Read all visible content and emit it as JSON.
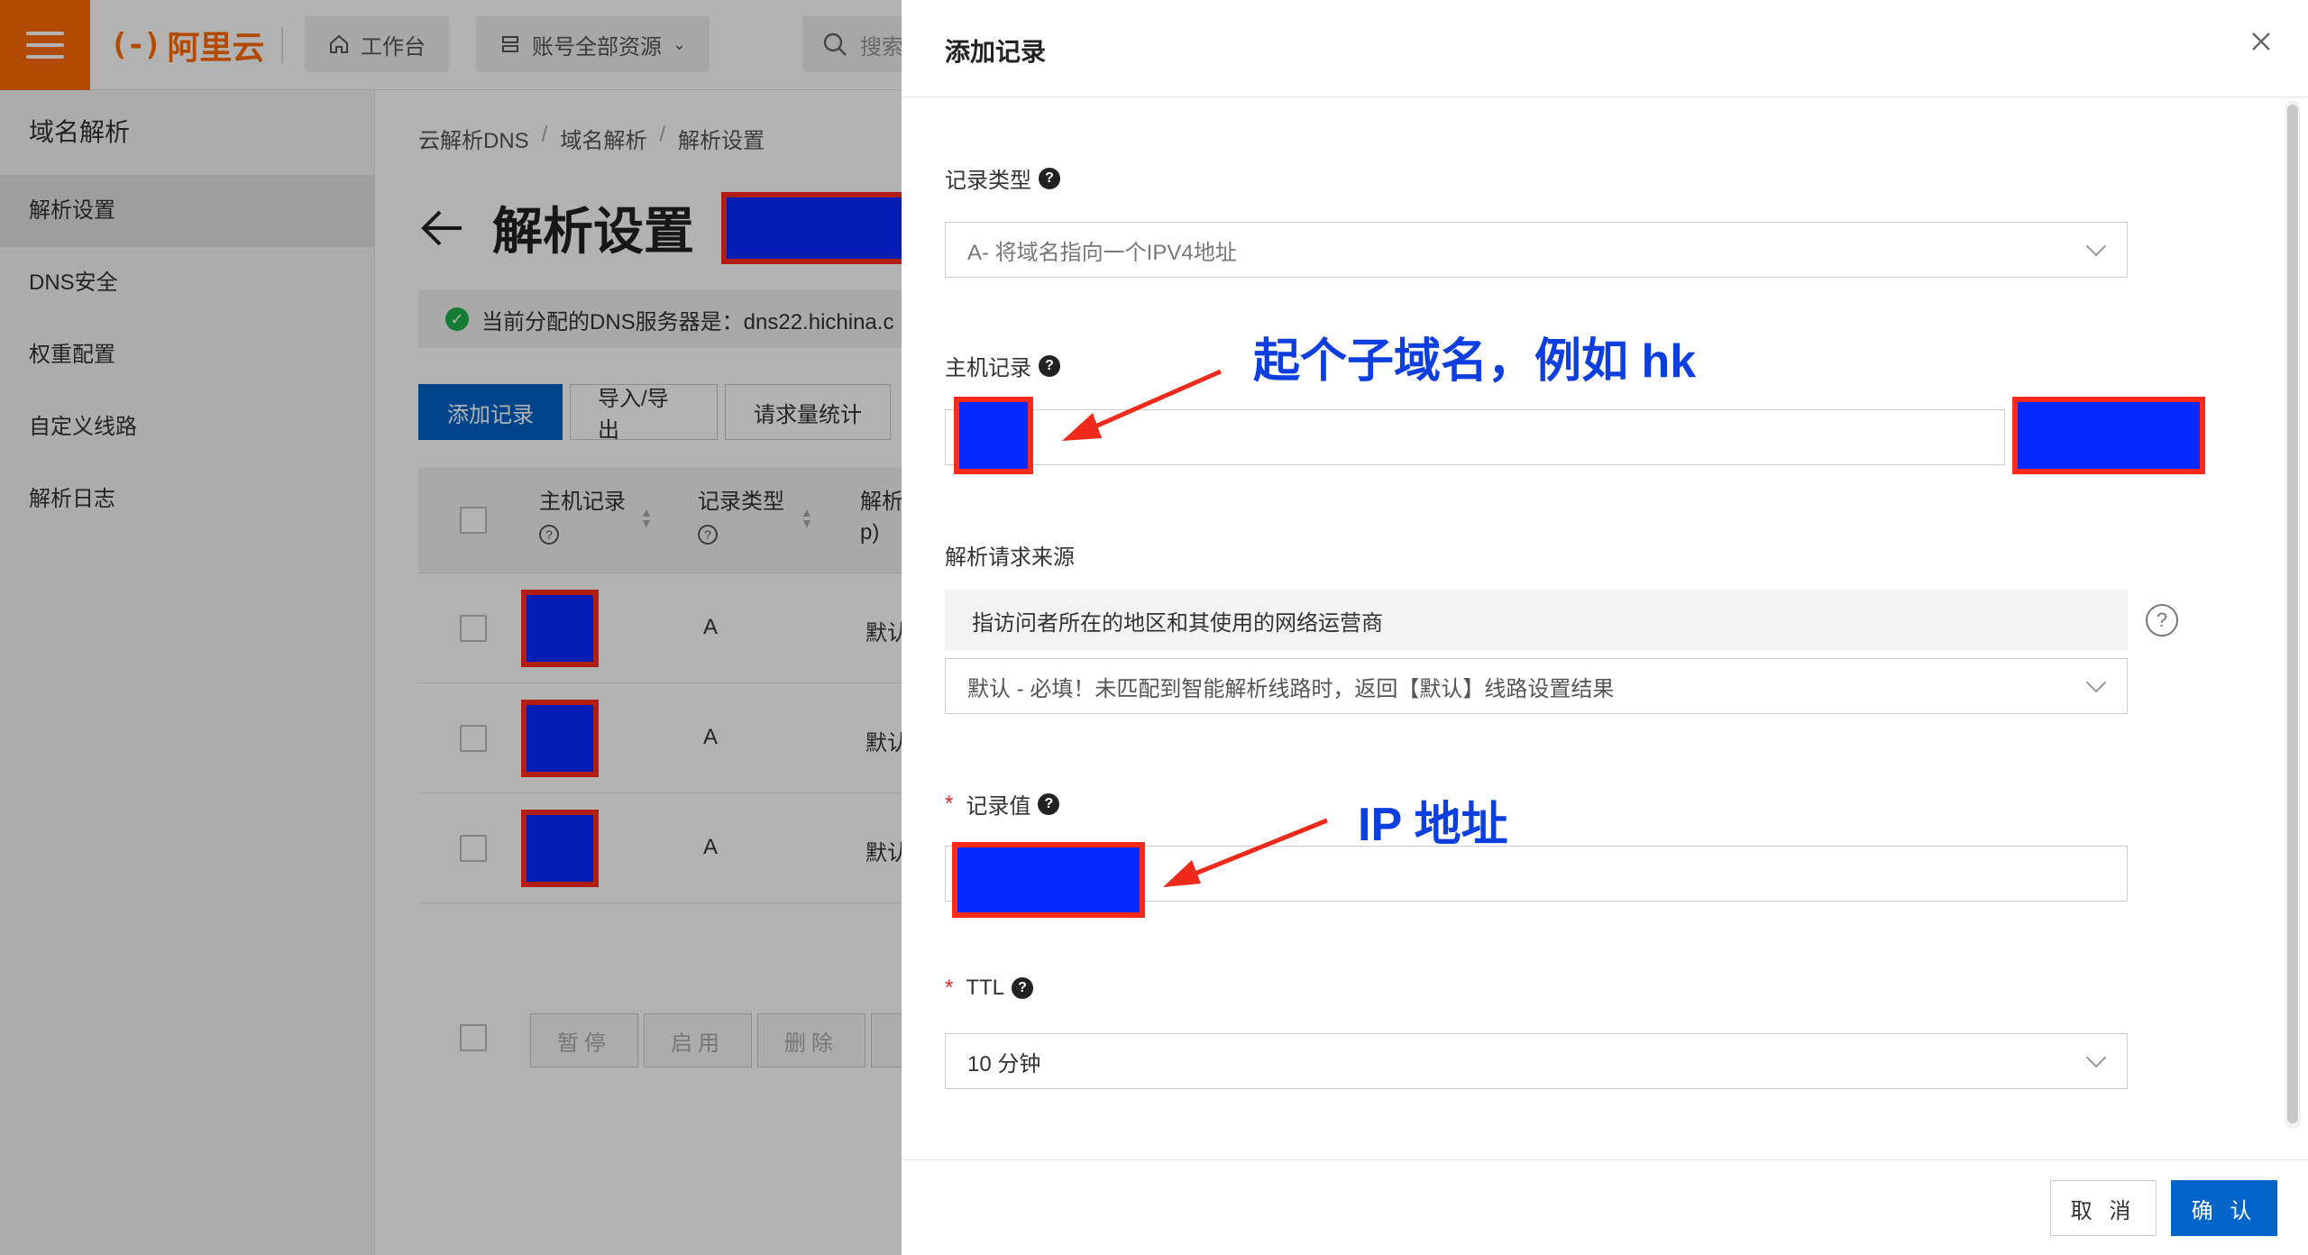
{
  "topbar": {
    "brand": "阿里云",
    "brand_mark": "(-)",
    "workbench": "工作台",
    "resources": "账号全部资源",
    "search_placeholder": "搜索"
  },
  "sidebar": {
    "title": "域名解析",
    "items": [
      {
        "label": "解析设置",
        "active": true
      },
      {
        "label": "DNS安全"
      },
      {
        "label": "权重配置"
      },
      {
        "label": "自定义线路"
      },
      {
        "label": "解析日志"
      }
    ]
  },
  "main": {
    "breadcrumb": [
      "云解析DNS",
      "域名解析",
      "解析设置"
    ],
    "breadcrumb_sep": "/",
    "title": "解析设置",
    "dns_notice": "当前分配的DNS服务器是：dns22.hichina.c",
    "actions": [
      "添加记录",
      "导入/导出",
      "请求量统计"
    ],
    "table": {
      "headers": [
        "主机记录",
        "记录类型",
        "解析",
        "p)"
      ],
      "rows": [
        {
          "type": "A",
          "line": "默认"
        },
        {
          "type": "A",
          "line": "默认"
        },
        {
          "type": "A",
          "line": "默认"
        }
      ]
    },
    "bulk_actions": [
      "暂停",
      "启用",
      "删除"
    ]
  },
  "drawer": {
    "title": "添加记录",
    "record_type_label": "记录类型",
    "record_type_value": "A- 将域名指向一个IPV4地址",
    "host_label": "主机记录",
    "source_label": "解析请求来源",
    "source_info": "指访问者所在的地区和其使用的网络运营商",
    "source_value": "默认 - 必填！未匹配到智能解析线路时，返回【默认】线路设置结果",
    "value_label": "记录值",
    "ttl_label": "TTL",
    "ttl_value": "10 分钟",
    "cancel": "取 消",
    "confirm": "确 认"
  },
  "annotations": {
    "subdomain": "起个子域名，例如 hk",
    "ip": "IP 地址"
  },
  "colors": {
    "brand": "#ff6a00",
    "primary": "#0064c8",
    "redaction_fill": "#0529ff",
    "redaction_border": "#ff2a1a",
    "annotation_text": "#0d3fe0",
    "annotation_arrow": "#f02a1a",
    "success": "#1db04a"
  }
}
